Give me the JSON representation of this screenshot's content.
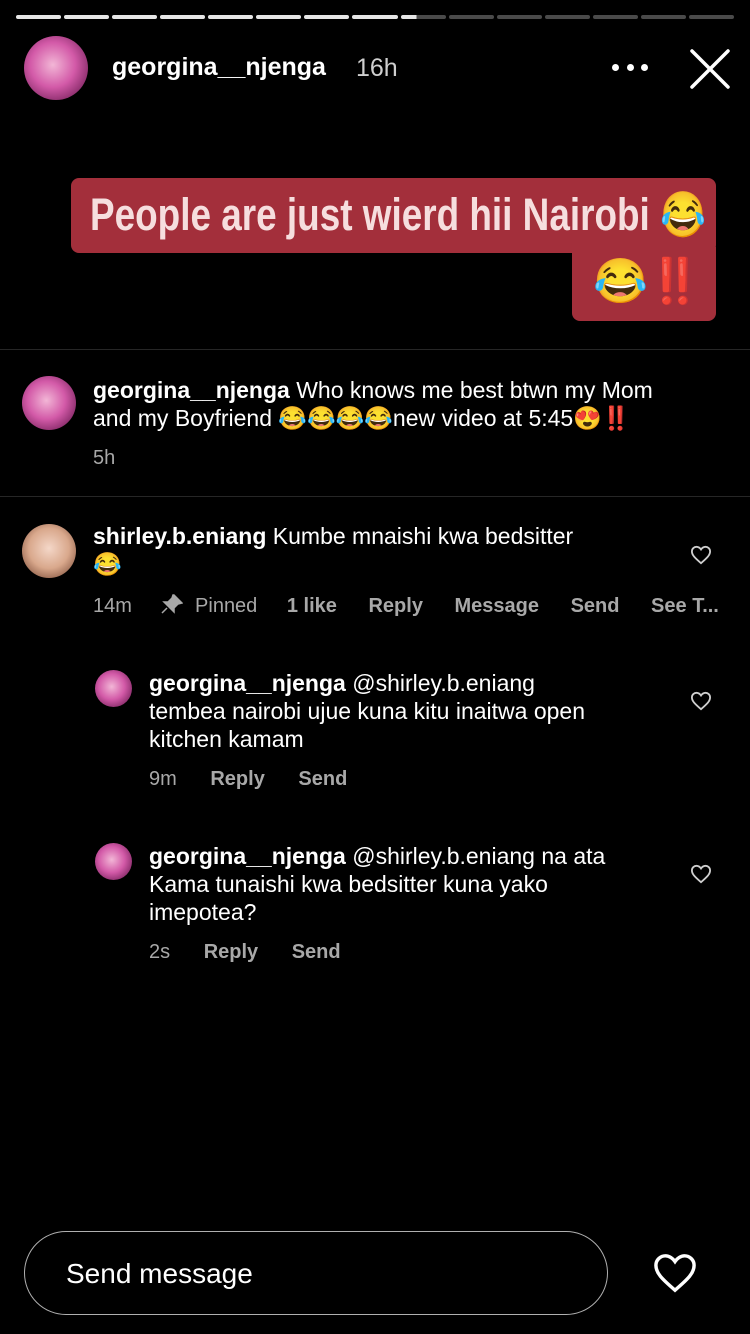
{
  "story": {
    "username": "georgina__njenga",
    "time": "16h",
    "progress_total": 15,
    "progress_done": 8,
    "progress_current_fraction": 0.35,
    "sticker_line1": "People are just wierd hii Nairobi 😂",
    "sticker_line2": "😂‼️",
    "sticker_color": "#a32f3b"
  },
  "caption": {
    "username": "georgina__njenga",
    "text_line1": "Who knows me best btwn my Mom",
    "text_line2": "and my Boyfriend 😂😂😂😂new video at 5:45😍‼️",
    "time": "5h"
  },
  "comment": {
    "username": "shirley.b.eniang",
    "text_line1": "Kumbe mnaishi kwa bedsitter",
    "text_line2": "😂",
    "time": "14m",
    "pinned": "Pinned",
    "likes": "1 like",
    "reply": "Reply",
    "message": "Message",
    "send": "Send",
    "see": "See T..."
  },
  "replies": [
    {
      "username": "georgina__njenga",
      "line1": "@shirley.b.eniang",
      "line2": "tembea nairobi ujue kuna kitu inaitwa open",
      "line3": "kitchen kamam",
      "time": "9m",
      "reply": "Reply",
      "send": "Send"
    },
    {
      "username": "georgina__njenga",
      "line1": "@shirley.b.eniang na ata",
      "line2": "Kama tunaishi kwa bedsitter kuna yako",
      "line3": "imepotea?",
      "time": "2s",
      "reply": "Reply",
      "send": "Send"
    }
  ],
  "footer": {
    "placeholder": "Send message"
  },
  "icons": {
    "more": "more-icon",
    "close": "close-icon",
    "heart": "heart-icon",
    "pin": "pin-icon"
  }
}
